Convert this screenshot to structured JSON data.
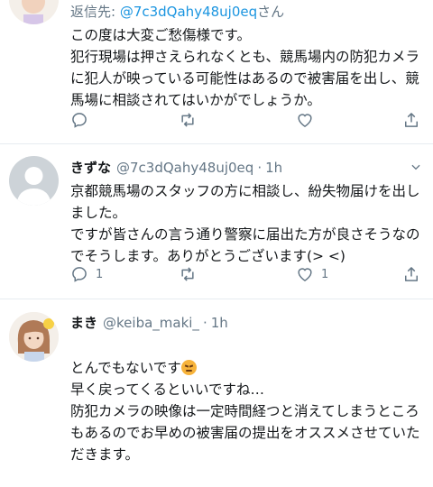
{
  "tweets": [
    {
      "reply_prefix": "返信先: ",
      "reply_handle": "@7c3dQahy48uj0eq",
      "reply_suffix": "さん",
      "text": "この度は大変ご愁傷様です。\n犯行現場は押さえられなくとも、競馬場内の防犯カメラに犯人が映っている可能性はあるので被害届を出し、競馬場に相談されてはいかがでしょうか。",
      "actions": {
        "reply": "",
        "retweet": "",
        "like": "",
        "share": ""
      }
    },
    {
      "name": "きずな",
      "handle": "@7c3dQahy48uj0eq",
      "dot": "·",
      "time": "1h",
      "text": "京都競馬場のスタッフの方に相談し、紛失物届けを出しました。\nですが皆さんの言う通り警察に届出た方が良さそうなのでそうします。ありがとうございます(> <)",
      "actions": {
        "reply": "1",
        "retweet": "",
        "like": "1",
        "share": ""
      }
    },
    {
      "name": "まき",
      "handle": "@keiba_maki_",
      "dot": "·",
      "time": "1h",
      "text_line1": "とんでもないです",
      "emoji": "persevering-face-emoji",
      "text_rest": "早く戻ってくるといいですね…\n防犯カメラの映像は一定時間経つと消えてしまうところもあるのでお早めの被害届の提出をオススメさせていただきます。"
    }
  ],
  "colors": {
    "accent": "#1b95e0",
    "muted": "#657786",
    "text": "#14171a",
    "divider": "#e6ecf0"
  }
}
